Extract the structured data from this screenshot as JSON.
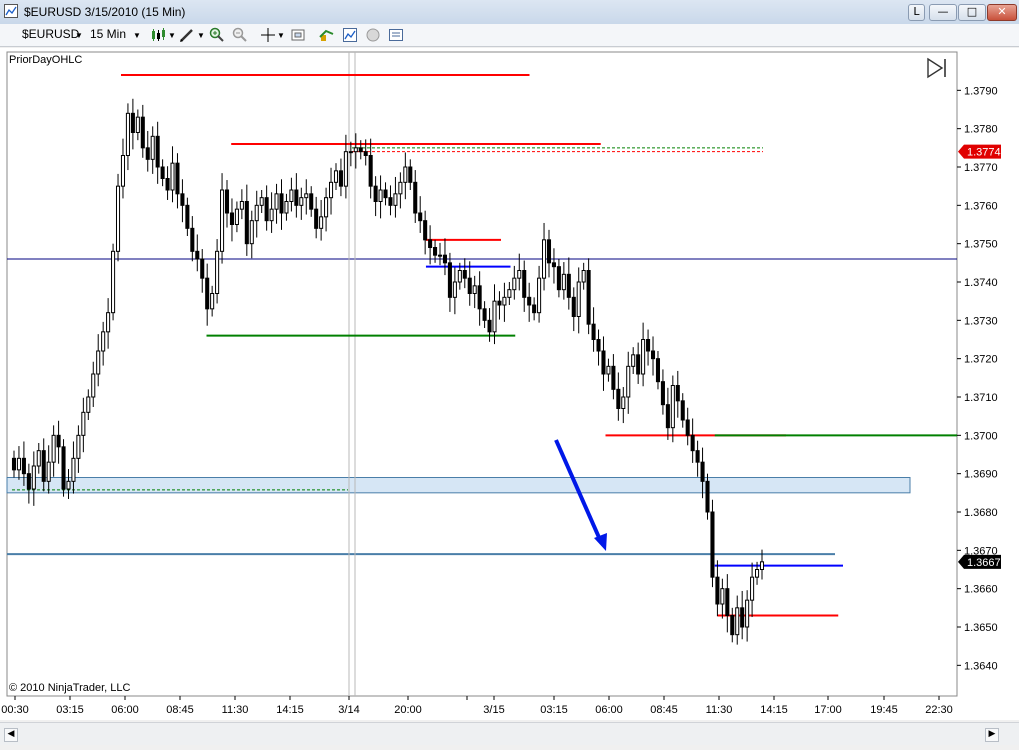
{
  "window": {
    "title": "$EURUSD  3/15/2010 (15 Min)",
    "buttons": {
      "pin": "L",
      "minimize": "—",
      "maximize": "□",
      "close": "✕"
    }
  },
  "toolbar": {
    "instrument": "$EURUSD",
    "interval": "15 Min",
    "icons": [
      "bar-type-icon",
      "drawing-pencil-icon",
      "zoom-in-icon",
      "zoom-out-icon",
      "crosshair-icon",
      "snapshot-icon",
      "strategy-icon",
      "indicators-icon",
      "properties-icon",
      "data-box-icon"
    ]
  },
  "chart": {
    "indicator_label": "PriorDayOHLC",
    "copyright": "© 2010 NinjaTrader, LLC",
    "colors": {
      "up": "#ffffff",
      "down": "#000000",
      "red": "#ff0000",
      "green": "#008000",
      "navy": "#000080",
      "blue": "#0000ff",
      "zone": "#d6e6f5",
      "steel": "#4a7ea8",
      "arrow": "#0018e8"
    }
  },
  "chart_data": {
    "type": "candlestick",
    "title": "$EURUSD 3/15/2010 (15 Min)",
    "ylim": [
      1.3632,
      1.38
    ],
    "y_ticks": [
      "1.3790",
      "1.3780",
      "1.3770",
      "1.3760",
      "1.3750",
      "1.3740",
      "1.3730",
      "1.3720",
      "1.3710",
      "1.3700",
      "1.3690",
      "1.3680",
      "1.3670",
      "1.3660",
      "1.3650",
      "1.3640"
    ],
    "x_ticks": [
      "00:30",
      "03:15",
      "06:00",
      "08:45",
      "11:30",
      "14:15",
      "3/14",
      "20:00",
      "3/15",
      "03:15",
      "06:00",
      "08:45",
      "11:30",
      "14:15",
      "17:00",
      "19:45",
      "22:30"
    ],
    "price_markers": [
      {
        "label": "1.3774",
        "value": 1.3774,
        "color": "#e00000"
      },
      {
        "label": "1.3667",
        "value": 1.3667,
        "color": "#000000"
      }
    ],
    "closes": [
      1.3691,
      1.3694,
      1.369,
      1.3686,
      1.3692,
      1.3696,
      1.3688,
      1.3693,
      1.37,
      1.3697,
      1.3686,
      1.3688,
      1.3694,
      1.37,
      1.3706,
      1.371,
      1.3716,
      1.3722,
      1.3727,
      1.3732,
      1.3748,
      1.3765,
      1.3773,
      1.3784,
      1.3779,
      1.3783,
      1.3775,
      1.3772,
      1.3778,
      1.377,
      1.3767,
      1.3764,
      1.3771,
      1.3763,
      1.376,
      1.3754,
      1.3748,
      1.3746,
      1.3741,
      1.3733,
      1.3737,
      1.3748,
      1.3764,
      1.3758,
      1.3755,
      1.3759,
      1.3761,
      1.375,
      1.3756,
      1.376,
      1.3762,
      1.3756,
      1.3759,
      1.3763,
      1.3758,
      1.3761,
      1.3764,
      1.376,
      1.3762,
      1.3763,
      1.3759,
      1.3754,
      1.3757,
      1.3762,
      1.3766,
      1.3769,
      1.3765,
      1.3774,
      1.3774,
      1.3775,
      1.3774,
      1.3773,
      1.3765,
      1.3761,
      1.3764,
      1.3762,
      1.376,
      1.3763,
      1.3766,
      1.377,
      1.3766,
      1.3758,
      1.3756,
      1.3751,
      1.3749,
      1.3747,
      1.3747,
      1.3745,
      1.3736,
      1.374,
      1.3743,
      1.3741,
      1.3737,
      1.3739,
      1.3733,
      1.373,
      1.3727,
      1.3735,
      1.3734,
      1.3736,
      1.3738,
      1.3741,
      1.3743,
      1.3736,
      1.3734,
      1.3732,
      1.3741,
      1.3751,
      1.3745,
      1.3744,
      1.3738,
      1.3742,
      1.3736,
      1.3731,
      1.374,
      1.3743,
      1.3729,
      1.3725,
      1.3722,
      1.3716,
      1.3718,
      1.3712,
      1.3707,
      1.371,
      1.3718,
      1.3721,
      1.3716,
      1.3725,
      1.3722,
      1.372,
      1.3714,
      1.3708,
      1.3702,
      1.3713,
      1.3709,
      1.3704,
      1.37,
      1.3696,
      1.3693,
      1.3688,
      1.368,
      1.3663,
      1.3656,
      1.366,
      1.3653,
      1.3648,
      1.3655,
      1.365,
      1.3657,
      1.3663,
      1.3665,
      1.3667
    ],
    "levels": [
      {
        "name": "prior-day-high-1",
        "value": 1.3794,
        "color": "#ff0000",
        "x_from": 0.12,
        "x_to": 0.55
      },
      {
        "name": "prior-day-high-2",
        "value": 1.3776,
        "color": "#ff0000",
        "x_from": 0.236,
        "x_to": 0.625
      },
      {
        "name": "prior-day-open",
        "value": 1.3751,
        "color": "#ff0000",
        "x_from": 0.441,
        "x_to": 0.52
      },
      {
        "name": "prior-day-close",
        "value": 1.3744,
        "color": "#0000ff",
        "x_from": 0.441,
        "x_to": 0.53
      },
      {
        "name": "prior-day-low",
        "value": 1.3726,
        "color": "#008000",
        "x_from": 0.21,
        "x_to": 0.535
      },
      {
        "name": "level-1.3700-red",
        "value": 1.37,
        "color": "#ff0000",
        "x_from": 0.63,
        "x_to": 0.82
      },
      {
        "name": "level-1.3700-green",
        "value": 1.37,
        "color": "#008000",
        "x_from": 0.745,
        "x_to": 1.0
      },
      {
        "name": "level-1.3666-blue",
        "value": 1.3666,
        "color": "#0000ff",
        "x_from": 0.745,
        "x_to": 0.88
      },
      {
        "name": "level-1.3653-red",
        "value": 1.3653,
        "color": "#ff0000",
        "x_from": 0.748,
        "x_to": 0.875
      }
    ],
    "horizontal_lines": [
      {
        "name": "navy-line",
        "value": 1.3746,
        "color": "#000080"
      },
      {
        "name": "steel-line",
        "value": 1.3669,
        "color": "#4a7ea8"
      }
    ],
    "zone": {
      "from": 1.3685,
      "to": 1.3689
    },
    "annotations": [
      "blue down arrow near 1.3700",
      "session divider at 3/14"
    ]
  }
}
